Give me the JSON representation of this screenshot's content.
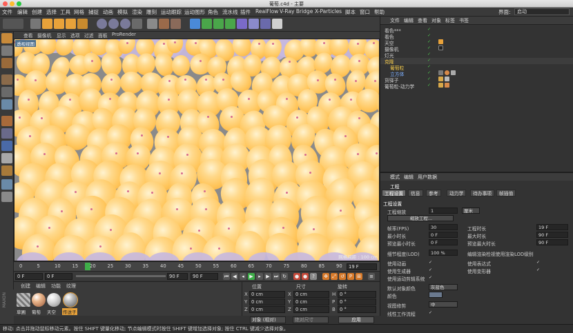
{
  "window": {
    "title": "葡萄.c4d - 主要"
  },
  "menu": [
    "文件",
    "编辑",
    "创建",
    "选择",
    "工具",
    "网格",
    "捕捉",
    "动画",
    "模拟",
    "渲染",
    "雕刻",
    "运动跟踪",
    "运动图形",
    "角色",
    "流水线",
    "插件",
    "RealFlow",
    "V-Ray Bridge",
    "X-Particles",
    "脚本",
    "窗口",
    "帮助"
  ],
  "layout": {
    "label": "界面:",
    "value": "启动"
  },
  "viewport": {
    "menu": [
      "查看",
      "摄像机",
      "显示",
      "选项",
      "过滤",
      "面板",
      "ProRender"
    ],
    "label": "透视视图",
    "grid_text": "网格间距 : 100 cm",
    "accent": "#ffc55a"
  },
  "timeline": {
    "ticks": [
      "0",
      "5",
      "10",
      "15",
      "20",
      "25",
      "30",
      "35",
      "40",
      "45",
      "50",
      "55",
      "60",
      "65",
      "70",
      "75",
      "80",
      "85",
      "90"
    ],
    "current": "19",
    "frame_display": "19 F",
    "playhead_frame": 19
  },
  "transport": {
    "start": "0 F",
    "min": "0 F",
    "max": "90 F",
    "end": "90 F"
  },
  "materials": {
    "menu": [
      "创建",
      "编辑",
      "功能",
      "纹理"
    ],
    "items": [
      {
        "name": "草圃"
      },
      {
        "name": "葡萄"
      },
      {
        "name": "天空"
      },
      {
        "name": "传送子"
      }
    ]
  },
  "coords": {
    "headers": [
      "位置",
      "尺寸",
      "旋转"
    ],
    "rows": [
      {
        "axis": "X",
        "pos": "0 cm",
        "size_axis": "X",
        "size": "0 cm",
        "rot_axis": "H",
        "rot": "0 °"
      },
      {
        "axis": "Y",
        "pos": "0 cm",
        "size_axis": "Y",
        "size": "0 cm",
        "rot_axis": "P",
        "rot": "0 °"
      },
      {
        "axis": "Z",
        "pos": "0 cm",
        "size_axis": "Z",
        "size": "0 cm",
        "rot_axis": "B",
        "rot": "0 °"
      }
    ],
    "mode": "对象 (相对)",
    "size_mode": "绝对尺寸",
    "apply": "应用"
  },
  "objects": {
    "menu": [
      "文件",
      "编辑",
      "查看",
      "对象",
      "标签",
      "书签"
    ],
    "items": [
      {
        "name": "看色***",
        "indent": 0
      },
      {
        "name": "看色",
        "indent": 0
      },
      {
        "name": "天空",
        "indent": 0
      },
      {
        "name": "摄像机",
        "indent": 0
      },
      {
        "name": "灯光",
        "indent": 0
      },
      {
        "name": "克隆",
        "indent": 0
      },
      {
        "name": "葡萄粒",
        "indent": 1
      },
      {
        "name": "立方体",
        "indent": 1
      },
      {
        "name": "货驿子",
        "indent": 0
      },
      {
        "name": "葡萄粒-动力学",
        "indent": 0
      }
    ]
  },
  "attributes": {
    "menu": [
      "模式",
      "编辑",
      "用户数据"
    ],
    "section": "工程",
    "tabs": [
      "工程设置",
      "信息",
      "参考",
      "动力学",
      "待办事项",
      "帧插值"
    ],
    "group": "工程设置",
    "scale_label": "工程缩放",
    "scale_value": "1",
    "scale_unit": "厘米",
    "scale_button": "缩放工程...",
    "fps_label": "帧率(FPS)",
    "fps": "30",
    "min_time_label": "最小时长",
    "min_time": "0 F",
    "preview_min_label": "预览最小时长",
    "preview_min": "0 F",
    "lod_label": "细节程度(LOD)",
    "lod": "100 %",
    "project_time_label": "工程时长",
    "project_time": "19 F",
    "max_time_label": "最大时长",
    "max_time": "90 F",
    "preview_max_label": "预览最大时长",
    "preview_max": "90 F",
    "render_lod_label": "编辑渲染检视使用渲染LOD级别",
    "use_anim": "使用动画",
    "use_gen": "使用生成器",
    "use_motion": "使用运动剪辑系统",
    "use_expr": "使用表达式",
    "use_deform": "使用变形器",
    "default_color_label": "默认对象颜色",
    "default_color": "灰蓝色",
    "color_label": "颜色",
    "view_clip_label": "视图修剪",
    "view_clip": "中",
    "linear_label": "线性工作流程",
    "input_color_label": "输入色彩特性",
    "input_color": "sRGB"
  },
  "status": "移动: 点击并拖动鼠标移动元素。按住 SHIFT 键量化移动; 节点编辑模式时按住 SHIFT 键增加选择对象; 按住 CTRL 键减少选择对象。"
}
